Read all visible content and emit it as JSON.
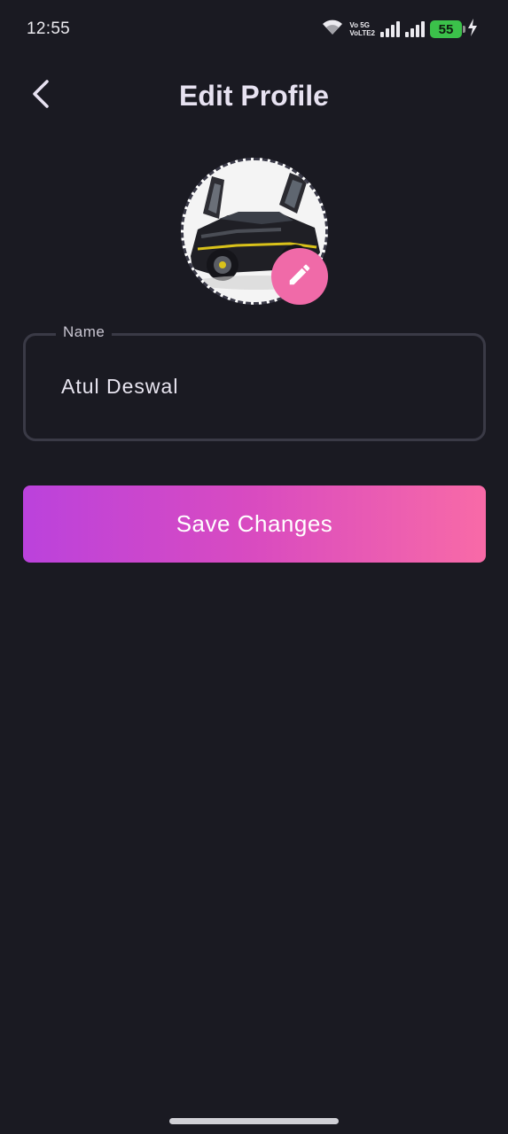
{
  "status_bar": {
    "time": "12:55",
    "network_top": "Vo 5G",
    "network_bottom": "VoLTE2",
    "battery_level": "55",
    "icons": [
      "wifi-icon",
      "signal-icon",
      "signal-icon",
      "battery-icon",
      "charging-icon"
    ]
  },
  "header": {
    "title": "Edit Profile",
    "back_icon": "chevron-left-icon"
  },
  "avatar": {
    "edit_icon": "pencil-icon",
    "edit_button_color": "#f06aa8"
  },
  "form": {
    "name_label": "Name",
    "name_value": "Atul Deswal"
  },
  "actions": {
    "save_label": "Save Changes",
    "gradient_start": "#bb42dc",
    "gradient_end": "#f86aa7"
  },
  "colors": {
    "background": "#1a1a22",
    "field_border": "#3a3a46"
  }
}
